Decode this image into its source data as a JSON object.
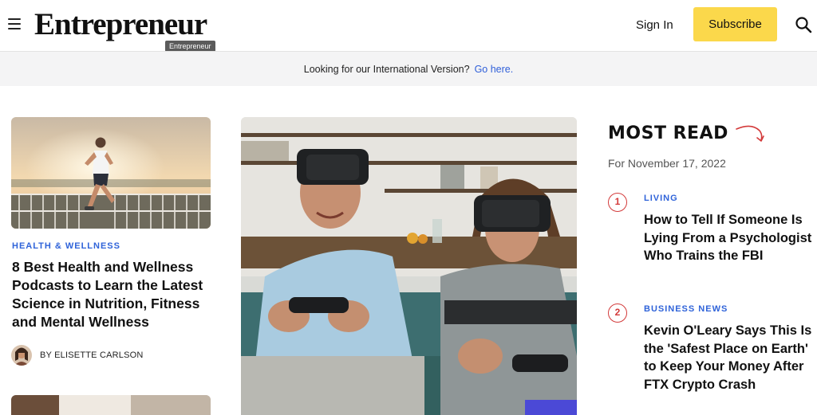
{
  "header": {
    "logo": "Entrepreneur",
    "tooltip": "Entrepreneur",
    "sign_in": "Sign In",
    "subscribe": "Subscribe"
  },
  "intl_banner": {
    "text": "Looking for our International Version?",
    "link": "Go here."
  },
  "featured_left": {
    "category": "HEALTH & WELLNESS",
    "headline": "8 Best Health and Wellness Podcasts to Learn the Latest Science in Nutrition, Fitness and Mental Wellness",
    "author": "BY ELISETTE CARLSON"
  },
  "most_read": {
    "title": "MOST READ",
    "date": "For November 17, 2022",
    "items": [
      {
        "rank": "1",
        "category": "LIVING",
        "headline": "How to Tell If Someone Is Lying From a Psychologist Who Trains the FBI"
      },
      {
        "rank": "2",
        "category": "BUSINESS NEWS",
        "headline": "Kevin O'Leary Says This Is the 'Safest Place on Earth' to Keep Your Money After FTX Crypto Crash"
      }
    ]
  },
  "colors": {
    "accent_blue": "#2f63d9",
    "subscribe_yellow": "#fbd84b",
    "rank_red": "#d33a3a"
  }
}
